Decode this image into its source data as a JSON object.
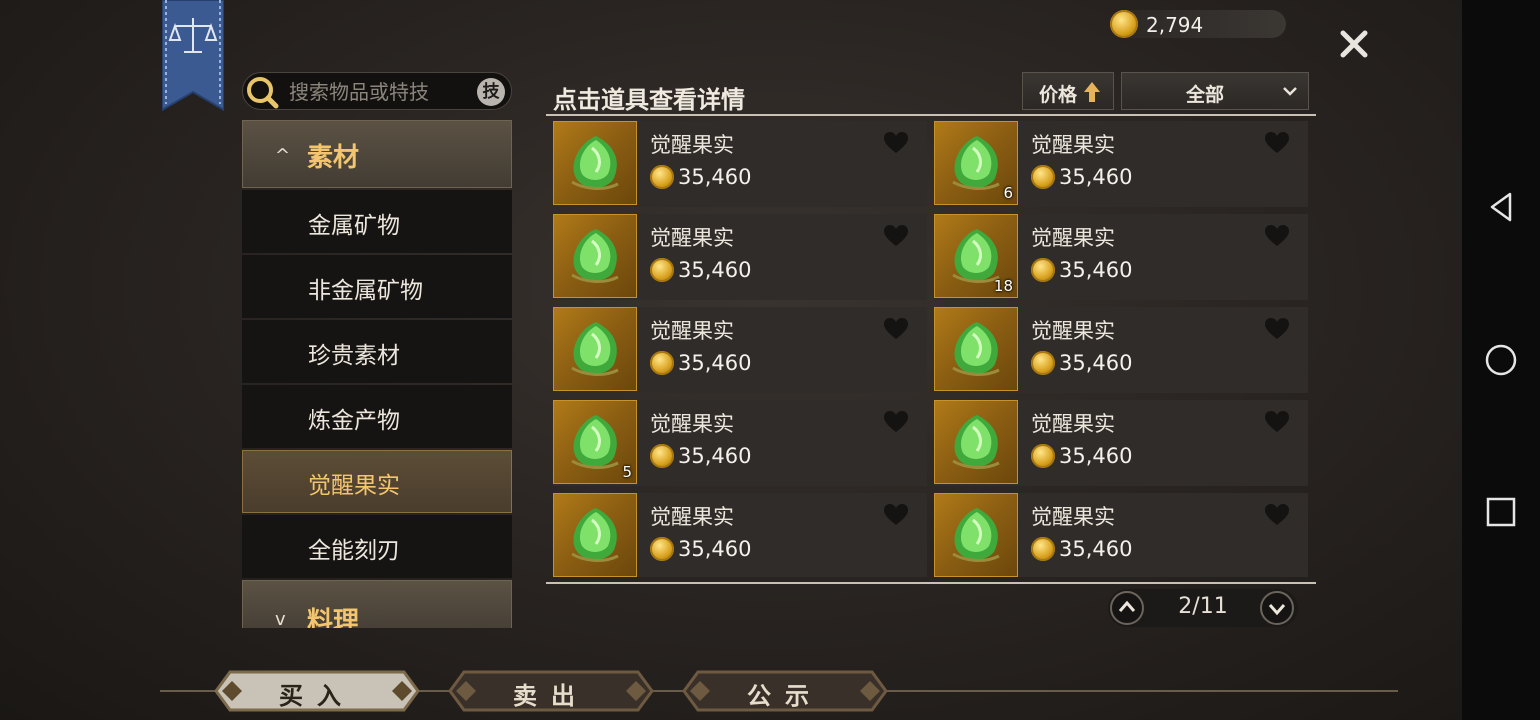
{
  "header": {
    "gold": "2,794"
  },
  "search": {
    "placeholder": "搜索物品或特技",
    "skill_label": "技"
  },
  "categories": {
    "material": {
      "label": "素材"
    },
    "subitems": [
      {
        "label": "金属矿物"
      },
      {
        "label": "非金属矿物"
      },
      {
        "label": "珍贵素材"
      },
      {
        "label": "炼金产物"
      },
      {
        "label": "觉醒果实"
      },
      {
        "label": "全能刻刃"
      }
    ],
    "cooking": {
      "label": "料理"
    }
  },
  "panel": {
    "title": "点击道具查看详情",
    "sort_label": "价格",
    "filter_label": "全部"
  },
  "items": [
    {
      "name": "觉醒果实",
      "price": "35,460",
      "qty": ""
    },
    {
      "name": "觉醒果实",
      "price": "35,460",
      "qty": "6"
    },
    {
      "name": "觉醒果实",
      "price": "35,460",
      "qty": ""
    },
    {
      "name": "觉醒果实",
      "price": "35,460",
      "qty": "18"
    },
    {
      "name": "觉醒果实",
      "price": "35,460",
      "qty": ""
    },
    {
      "name": "觉醒果实",
      "price": "35,460",
      "qty": ""
    },
    {
      "name": "觉醒果实",
      "price": "35,460",
      "qty": "5"
    },
    {
      "name": "觉醒果实",
      "price": "35,460",
      "qty": ""
    },
    {
      "name": "觉醒果实",
      "price": "35,460",
      "qty": ""
    },
    {
      "name": "觉醒果实",
      "price": "35,460",
      "qty": ""
    }
  ],
  "pager": {
    "page": "2/11"
  },
  "tabs": [
    {
      "label": "买入"
    },
    {
      "label": "卖出"
    },
    {
      "label": "公示"
    }
  ],
  "colors": {
    "accent_gold": "#f2c56e",
    "card_bg": "#2f2c29"
  }
}
